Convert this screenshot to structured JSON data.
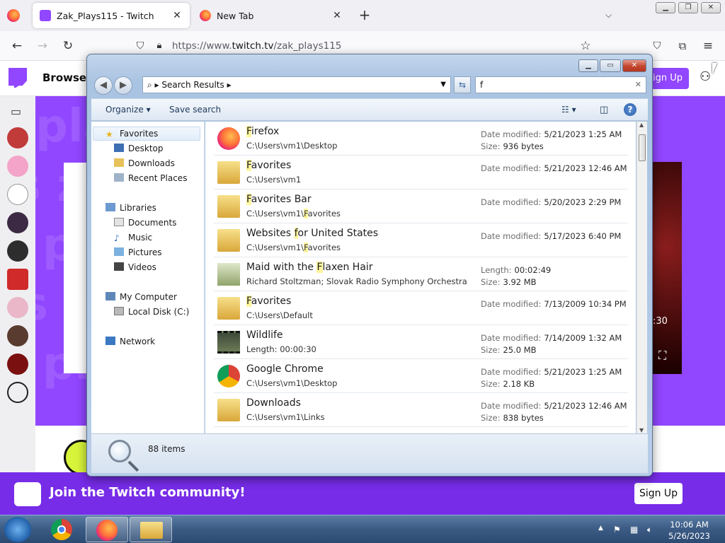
{
  "browser": {
    "tabs": [
      {
        "title": "Zak_Plays115 - Twitch",
        "active": true
      },
      {
        "title": "New Tab",
        "active": false
      }
    ],
    "url_prefix": "https://www.",
    "url_domain": "twitch.tv",
    "url_path": "/zak_plays115"
  },
  "twitch": {
    "browse_label": "Browse",
    "signup_label": "Sign Up",
    "banner_text": "Join the Twitch community!",
    "banner_signup": "Sign Up",
    "video_time": ":30",
    "colors": {
      "brand": "#9146ff",
      "banner": "#772ce8"
    }
  },
  "explorer": {
    "breadcrumb": "Search Results",
    "search_query": "f",
    "toolbar": {
      "organize": "Organize",
      "save_search": "Save search"
    },
    "nav": {
      "favorites": "Favorites",
      "desktop": "Desktop",
      "downloads": "Downloads",
      "recent_places": "Recent Places",
      "libraries": "Libraries",
      "documents": "Documents",
      "music": "Music",
      "pictures": "Pictures",
      "videos": "Videos",
      "my_computer": "My Computer",
      "local_disk": "Local Disk (C:)",
      "network": "Network"
    },
    "results": [
      {
        "hl": "F",
        "name_rest": "irefox",
        "pre": "",
        "path": "C:\\Users\\vm1\\Desktop",
        "path_hl": "",
        "path_rest": "",
        "k1": "Date modified:",
        "v1": "5/21/2023 1:25 AM",
        "k2": "Size:",
        "v2": "936 bytes",
        "icon": "firefox-shortcut-icon"
      },
      {
        "hl": "F",
        "name_rest": "avorites",
        "pre": "",
        "path": "C:\\Users\\vm1",
        "path_hl": "",
        "path_rest": "",
        "k1": "Date modified:",
        "v1": "5/21/2023 12:46 AM",
        "k2": "",
        "v2": "",
        "icon": "favorites-folder-icon"
      },
      {
        "hl": "F",
        "name_rest": "avorites Bar",
        "pre": "",
        "path": "C:\\Users\\vm1\\",
        "path_hl": "F",
        "path_rest": "avorites",
        "k1": "Date modified:",
        "v1": "5/20/2023 2:29 PM",
        "k2": "",
        "v2": "",
        "icon": "folder-icon"
      },
      {
        "hl": "f",
        "name_rest": "or United States",
        "pre": "Websites ",
        "path": "C:\\Users\\vm1\\",
        "path_hl": "F",
        "path_rest": "avorites",
        "k1": "Date modified:",
        "v1": "5/17/2023 6:40 PM",
        "k2": "",
        "v2": "",
        "icon": "folder-icon"
      },
      {
        "hl": "F",
        "name_rest": "laxen Hair",
        "pre": "Maid with the ",
        "path": "Richard Stoltzman; Slovak Radio Symphony Orchestra",
        "path_hl": "",
        "path_rest": "",
        "k1": "Length:",
        "v1": "00:02:49",
        "k2": "Size:",
        "v2": "3.92 MB",
        "icon": "music-thumbnail-icon"
      },
      {
        "hl": "F",
        "name_rest": "avorites",
        "pre": "",
        "path": "C:\\Users\\Default",
        "path_hl": "",
        "path_rest": "",
        "k1": "Date modified:",
        "v1": "7/13/2009 10:34 PM",
        "k2": "",
        "v2": "",
        "icon": "folder-icon"
      },
      {
        "hl": "",
        "name_rest": "",
        "pre": "Wildlife",
        "path": "Length: 00:00:30",
        "path_hl": "",
        "path_rest": "",
        "k1": "Date modified:",
        "v1": "7/14/2009 1:32 AM",
        "k2": "Size:",
        "v2": "25.0 MB",
        "icon": "video-thumbnail-icon"
      },
      {
        "hl": "",
        "name_rest": "",
        "pre": "Google Chrome",
        "path": "C:\\Users\\vm1\\Desktop",
        "path_hl": "",
        "path_rest": "",
        "k1": "Date modified:",
        "v1": "5/21/2023 1:25 AM",
        "k2": "Size:",
        "v2": "2.18 KB",
        "icon": "chrome-shortcut-icon"
      },
      {
        "hl": "",
        "name_rest": "",
        "pre": "Downloads",
        "path": "C:\\Users\\vm1\\Links",
        "path_hl": "",
        "path_rest": "",
        "k1": "Date modified:",
        "v1": "5/21/2023 12:46 AM",
        "k2": "Size:",
        "v2": "838 bytes",
        "icon": "downloads-shortcut-icon"
      }
    ],
    "item_count": "88 items"
  },
  "taskbar": {
    "time": "10:06 AM",
    "date": "5/26/2023"
  }
}
